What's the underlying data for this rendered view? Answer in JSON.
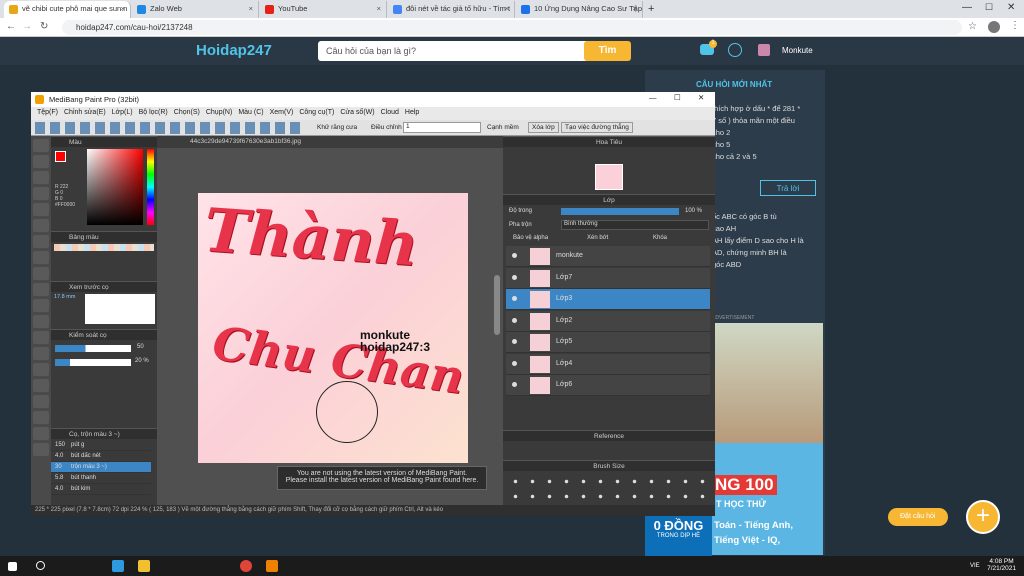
{
  "browser": {
    "tabs": [
      {
        "label": "vẽ chibi cute phô mai que sun.n",
        "color": "#e6a817",
        "active": true
      },
      {
        "label": "Zalo Web",
        "color": "#1e88e5",
        "active": false
      },
      {
        "label": "YouTube",
        "color": "#e62117",
        "active": false
      },
      {
        "label": "đôi nét về tác giả tố hữu - Tìm t",
        "color": "#4285f4",
        "active": false
      },
      {
        "label": "10 Ứng Dụng Nâng Cao Sư Tập",
        "color": "#1a73e8",
        "active": false
      }
    ],
    "url": "hoidap247.com/cau-hoi/2137248"
  },
  "site": {
    "logo": "Hoidap247",
    "search_placeholder": "Câu hỏi của bạn là gì?",
    "search_button": "Tìm",
    "user_name": "Monkute",
    "notif_count": "1",
    "sidebar_title": "CÂU HỎI MỚI NHẤT",
    "sidebar_lines": [
      "thích hợp ở dấu * để 281 *",
      "7 số ) thỏa mãn một điều",
      "cho 2",
      "cho 5",
      "cho cả 2 và 5"
    ],
    "answer_button": "Trả lời",
    "sidebar_lines2": [
      "ốc ABC có góc B tù",
      "cao AH",
      "AH lấy điểm D sao cho H là",
      "AD, chứng minh BH là",
      "góc ABD"
    ],
    "advertisement_label": "ADVERTISEMENT",
    "ad_texts": [
      "NG 100",
      "T HỌC THỬ",
      "0 ĐỒNG",
      "TRONG DỊP HÈ",
      "Toán - Tiếng Anh,",
      "Tiếng Việt - IQ,"
    ],
    "ask_button": "Đặt câu hỏi"
  },
  "medibang": {
    "title": "MediBang Paint Pro (32bit)",
    "menu": [
      "Tệp(F)",
      "Chỉnh sửa(E)",
      "Lớp(L)",
      "Bộ lọc(R)",
      "Chọn(S)",
      "Chụp(N)",
      "Màu (C)",
      "Xem(V)",
      "Công cụ(T)",
      "Cửa sổ(W)",
      "Cloud",
      "Help"
    ],
    "toolbar_antialias": "Khử răng cưa",
    "toolbar_correction": "Điều chỉnh",
    "toolbar_correction_value": "1",
    "toolbar_snap": "Cạnh mềm",
    "toolbar_clear": "Xóa lớp",
    "toolbar_create_ruler": "Tạo việc đường thẳng",
    "canvas_tab": "44c3c29de94739f67630e3ab1bf36.jpg",
    "panels": {
      "color": "Màu",
      "color_values": [
        "R 222",
        "G 0",
        "B 0",
        "#FF0000"
      ],
      "palette": "Bảng màu",
      "preview": "Xem trước cọ",
      "brush_size_label": "17.8 mm",
      "brush_control": "Kiểm soát cọ",
      "brush_size_val": "50",
      "brush_opacity_val": "20 %",
      "brush_list_title": "Cọ, trộn màu 3 ~)",
      "brushes": [
        {
          "size": "150",
          "name": "pút g"
        },
        {
          "size": "4.0",
          "name": "bút dấc nét"
        },
        {
          "size": "30",
          "name": "trộn màu 3 ~)"
        },
        {
          "size": "5.8",
          "name": "bút thanh"
        },
        {
          "size": "4.0",
          "name": "bút kim"
        }
      ],
      "navigator": "Hoa Tiêu",
      "layer": "Lớp",
      "opacity_label": "Độ trong",
      "opacity_value": "100 %",
      "blend_label": "Pha trộn",
      "blend_value": "Bình thường",
      "protect_alpha": "Bảo vệ alpha",
      "clipping": "Xén bớt",
      "lock": "Khóa",
      "layers": [
        {
          "name": "monkute",
          "selected": false
        },
        {
          "name": "Lớp7",
          "selected": false
        },
        {
          "name": "Lớp3",
          "selected": true
        },
        {
          "name": "Lớp2",
          "selected": false
        },
        {
          "name": "Lớp5",
          "selected": false
        },
        {
          "name": "Lớp4",
          "selected": false
        },
        {
          "name": "Lớp6",
          "selected": false
        }
      ],
      "reference": "Reference",
      "brush_size_panel": "Brush Size"
    },
    "canvas_text_1": "Thành",
    "canvas_text_2": "Chu Chan",
    "canvas_credit_1": "monkute",
    "canvas_credit_2": "hoidap247:3",
    "update_msg_1": "You are not using the latest version of MediBang Paint.",
    "update_msg_2": "Please install the latest version of MediBang Paint found here.",
    "status": "225 * 225 pixel  (7.8 * 7.8cm)  72 dpi  224 %  ( 125, 183 )  Vẽ một đường thẳng bằng cách giữ phím Shift, Thay đổi cỡ cọ bằng cách giữ phím Ctrl, Alt và kéo"
  },
  "taskbar": {
    "time": "4:08 PM",
    "date": "7/21/2021",
    "lang": "VIE"
  }
}
